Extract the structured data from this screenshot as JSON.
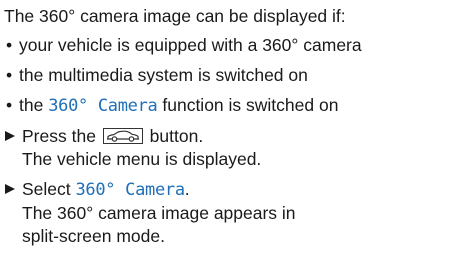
{
  "intro": "The 360° camera image can be displayed if:",
  "conditions": [
    {
      "text": "your vehicle is equipped with a 360° camera"
    },
    {
      "text": "the multimedia system is switched on"
    },
    {
      "before": "the ",
      "highlight": "360° Camera",
      "after": " function is switched on"
    }
  ],
  "steps": [
    {
      "before": "Press the ",
      "icon": "car-icon",
      "after": " button.",
      "result": "The vehicle menu is displayed."
    },
    {
      "before": "Select ",
      "highlight": "360° Camera",
      "after": ".",
      "result": "The 360° camera image appears in split-screen mode."
    }
  ],
  "colors": {
    "text": "#1a1a1a",
    "highlight": "#1f6fb8"
  }
}
